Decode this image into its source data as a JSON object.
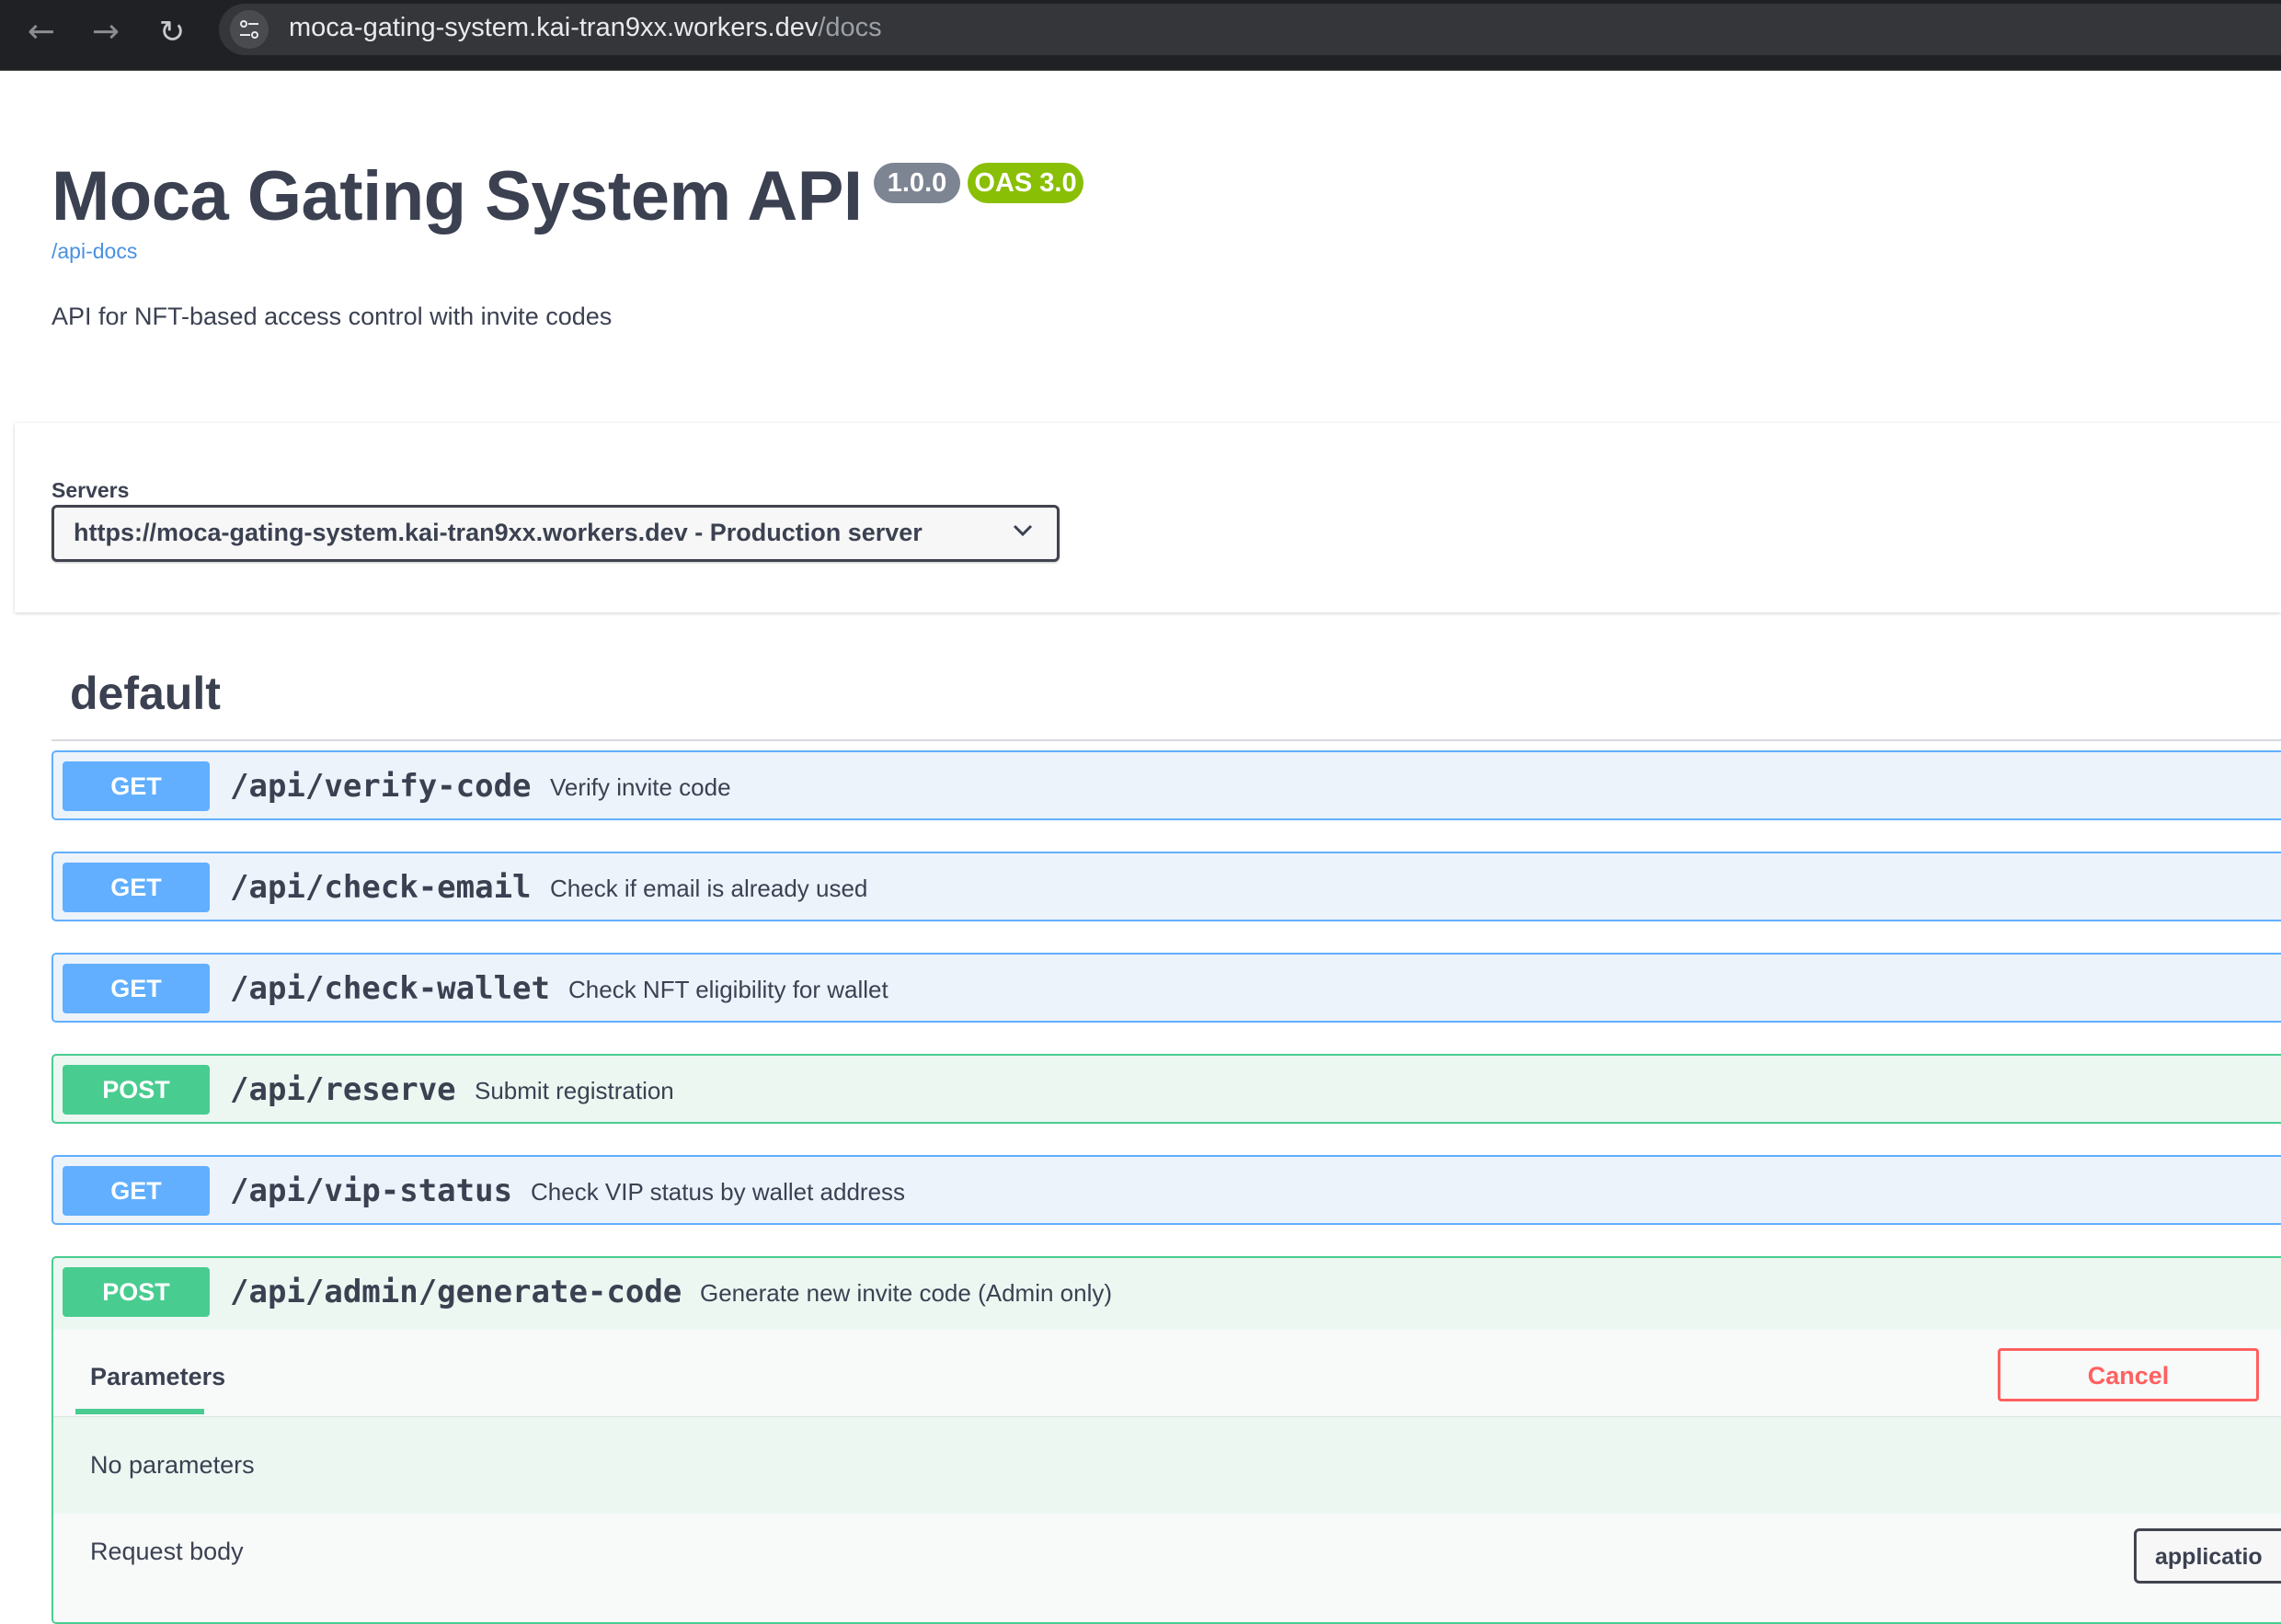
{
  "browser": {
    "url_host": "moca-gating-system.kai-tran9xx.workers.dev",
    "url_path": "/docs",
    "back_icon": "←",
    "forward_icon": "→",
    "reload_icon": "↻"
  },
  "info": {
    "title": "Moca Gating System API",
    "version_badge": "1.0.0",
    "oas_badge": "OAS 3.0",
    "docs_link": "/api-docs",
    "description": "API for NFT-based access control with invite codes"
  },
  "servers": {
    "label": "Servers",
    "selected": "https://moca-gating-system.kai-tran9xx.workers.dev - Production server"
  },
  "tag": {
    "name": "default"
  },
  "operations": [
    {
      "method": "GET",
      "path": "/api/verify-code",
      "summary": "Verify invite code"
    },
    {
      "method": "GET",
      "path": "/api/check-email",
      "summary": "Check if email is already used"
    },
    {
      "method": "GET",
      "path": "/api/check-wallet",
      "summary": "Check NFT eligibility for wallet"
    },
    {
      "method": "POST",
      "path": "/api/reserve",
      "summary": "Submit registration"
    },
    {
      "method": "GET",
      "path": "/api/vip-status",
      "summary": "Check VIP status by wallet address"
    },
    {
      "method": "POST",
      "path": "/api/admin/generate-code",
      "summary": "Generate new invite code (Admin only)"
    }
  ],
  "expanded": {
    "parameters_tab": "Parameters",
    "cancel_label": "Cancel",
    "no_parameters": "No parameters",
    "request_body_label": "Request body",
    "content_type": "applicatio"
  },
  "colors": {
    "get": "#61affe",
    "post": "#49cc90",
    "cancel": "#ff6060",
    "oas_badge": "#89bf04",
    "version_badge": "#7d8492"
  }
}
